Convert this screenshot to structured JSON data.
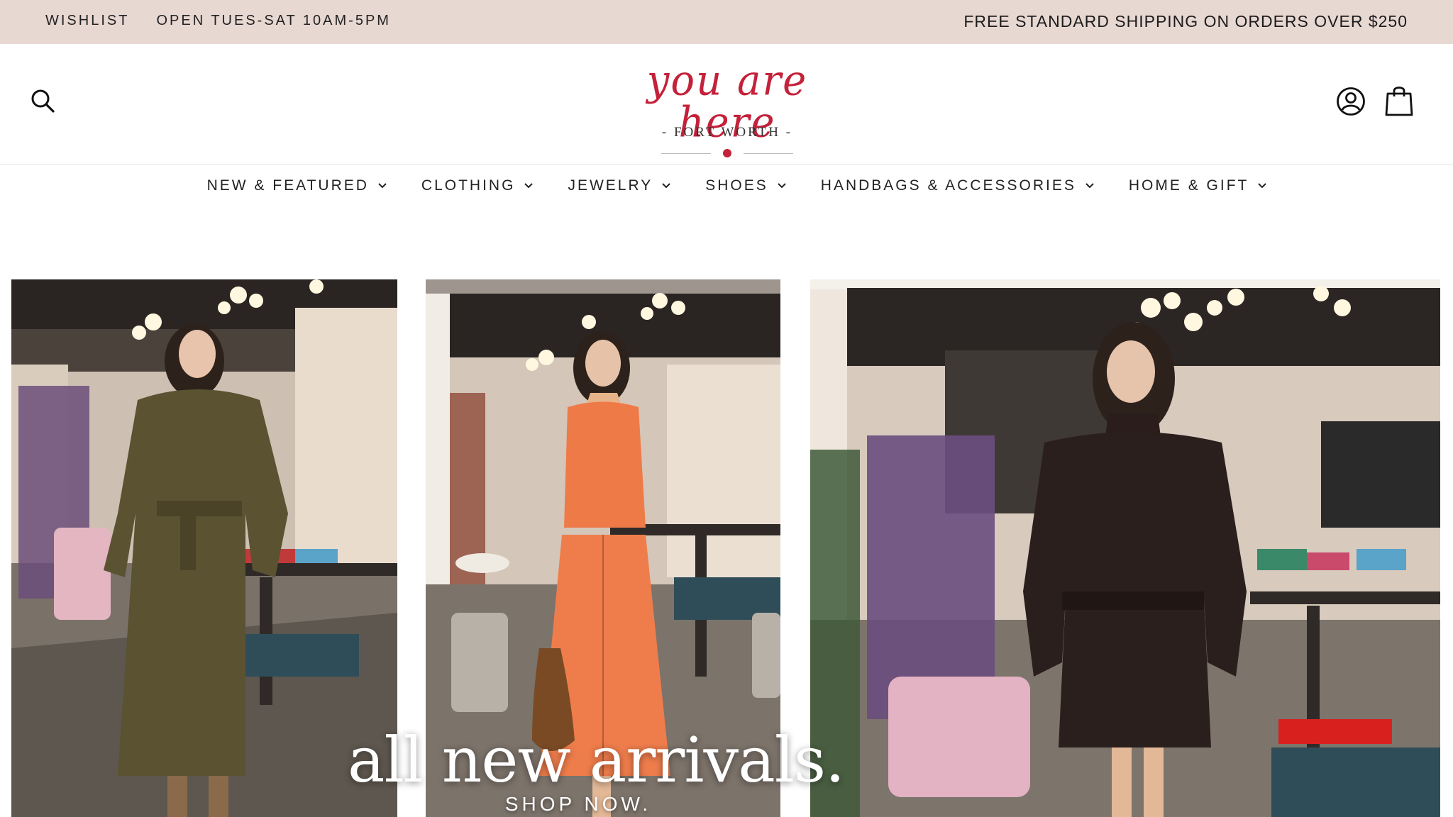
{
  "announcement": {
    "wishlist": "WISHLIST",
    "hours": "OPEN TUES-SAT 10AM-5PM",
    "shipping": "FREE STANDARD SHIPPING ON ORDERS OVER $250"
  },
  "header": {
    "logo_script": "you are here",
    "logo_sub": "- FORT WORTH -",
    "icons": {
      "search": "search-icon",
      "account": "account-icon",
      "cart": "shopping-bag-icon"
    }
  },
  "nav": {
    "items": [
      {
        "label": "NEW & FEATURED"
      },
      {
        "label": "CLOTHING"
      },
      {
        "label": "JEWELRY"
      },
      {
        "label": "SHOES"
      },
      {
        "label": "HANDBAGS & ACCESSORIES"
      },
      {
        "label": "HOME & GIFT"
      }
    ]
  },
  "hero": {
    "title": "all new arrivals.",
    "cta": "SHOP NOW."
  },
  "colors": {
    "announcement_bg": "#e8d8d2",
    "brand_red": "#c4213a"
  }
}
